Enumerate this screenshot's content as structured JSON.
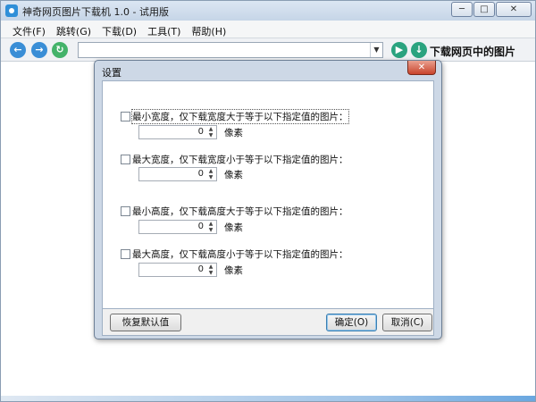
{
  "window": {
    "title": "神奇网页图片下载机 1.0 - 试用版",
    "controls": {
      "minimize": "─",
      "maximize": "□",
      "close": "✕"
    }
  },
  "menu": [
    "文件(F)",
    "跳转(G)",
    "下载(D)",
    "工具(T)",
    "帮助(H)"
  ],
  "toolbar": {
    "back_icon": "arrow-left-icon",
    "forward_icon": "arrow-right-icon",
    "refresh_icon": "refresh-icon",
    "url_value": "",
    "go_icon": "play-icon",
    "download_icon": "download-icon",
    "download_label": "下载网页中的图片"
  },
  "dialog": {
    "title": "设置",
    "close_label": "✕",
    "options": [
      {
        "label": "最小宽度，仅下载宽度大于等于以下指定值的图片：",
        "checked": false,
        "value": "0",
        "unit": "像素"
      },
      {
        "label": "最大宽度，仅下载宽度小于等于以下指定值的图片：",
        "checked": false,
        "value": "0",
        "unit": "像素"
      },
      {
        "label": "最小高度，仅下载高度大于等于以下指定值的图片：",
        "checked": false,
        "value": "0",
        "unit": "像素"
      },
      {
        "label": "最大高度，仅下载高度小于等于以下指定值的图片：",
        "checked": false,
        "value": "0",
        "unit": "像素"
      }
    ],
    "buttons": {
      "reset": "恢复默认值",
      "ok": "确定(O)",
      "cancel": "取消(C)"
    }
  },
  "colors": {
    "accent_blue": "#3a8ed6",
    "accent_green": "#2aa37f",
    "close_red": "#c9442c"
  }
}
